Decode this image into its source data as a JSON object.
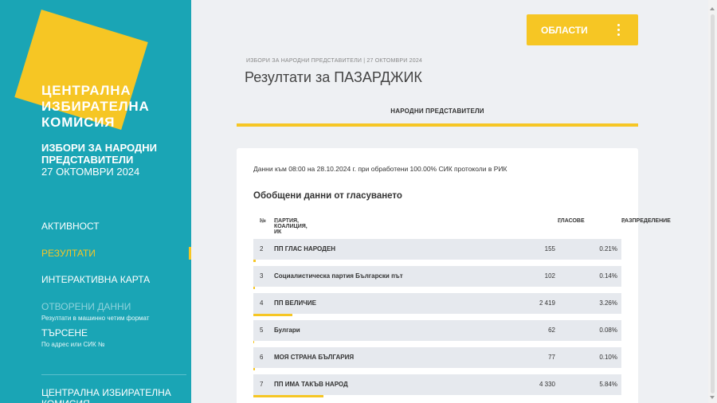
{
  "sidebar": {
    "logo_line1": "ЦЕНТРАЛНА",
    "logo_line2": "ИЗБИРАТЕЛНА",
    "logo_line3": "КОМИСИЯ",
    "election_title": "ИЗБОРИ ЗА НАРОДНИ ПРЕДСТАВИТЕЛИ",
    "election_date": "27 ОКТОМВРИ 2024",
    "nav": [
      {
        "label": "АКТИВНОСТ",
        "sub": ""
      },
      {
        "label": "РЕЗУЛТАТИ",
        "sub": ""
      },
      {
        "label": "ИНТЕРАКТИВНА КАРТА",
        "sub": ""
      },
      {
        "label": "ОТВОРЕНИ ДАННИ",
        "sub": "Резултати в машинно четим формат"
      },
      {
        "label": "ТЪРСЕНЕ",
        "sub": "По адрес или СИК №"
      }
    ],
    "footer": "ЦЕНТРАЛНА ИЗБИРАТЕЛНА КОМИСИЯ"
  },
  "header": {
    "regions_label": "ОБЛАСТИ",
    "breadcrumb": "ИЗБОРИ ЗА НАРОДНИ ПРЕДСТАВИТЕЛИ | 27 ОКТОМВРИ 2024",
    "title": "Резултати за ПАЗАРДЖИК"
  },
  "tabs": [
    {
      "label": "НАРОДНИ ПРЕДСТАВИТЕЛИ"
    }
  ],
  "results": {
    "note": "Данни към 08:00 на 28.10.2024 г. при обработени 100.00% СИК протоколи в РИК",
    "heading": "Обобщени данни от гласуването",
    "columns": {
      "num": "№",
      "party": "ПАРТИЯ, КОАЛИЦИЯ, ИК",
      "votes": "ГЛАСОВЕ",
      "share": "РАЗПРЕДЕЛЕНИЕ",
      "sort_icon": "⇅"
    },
    "rows": [
      {
        "num": "2",
        "party": "ПП ГЛАС НАРОДЕН",
        "votes": "155",
        "pct": "0.21%",
        "share": 0.21
      },
      {
        "num": "3",
        "party": "Социалистическа партия Български път",
        "votes": "102",
        "pct": "0.14%",
        "share": 0.14
      },
      {
        "num": "4",
        "party": "ПП ВЕЛИЧИЕ",
        "votes": "2 419",
        "pct": "3.26%",
        "share": 3.26
      },
      {
        "num": "5",
        "party": "Булгари",
        "votes": "62",
        "pct": "0.08%",
        "share": 0.08
      },
      {
        "num": "6",
        "party": "МОЯ СТРАНА БЪЛГАРИЯ",
        "votes": "77",
        "pct": "0.10%",
        "share": 0.1
      },
      {
        "num": "7",
        "party": "ПП ИМА ТАКЪВ НАРОД",
        "votes": "4 330",
        "pct": "5.84%",
        "share": 5.84
      }
    ],
    "bar_color": "#f6c624"
  },
  "colors": {
    "sidebar": "#1aa5b5",
    "accent": "#f6c624",
    "background": "#eef0f3"
  }
}
